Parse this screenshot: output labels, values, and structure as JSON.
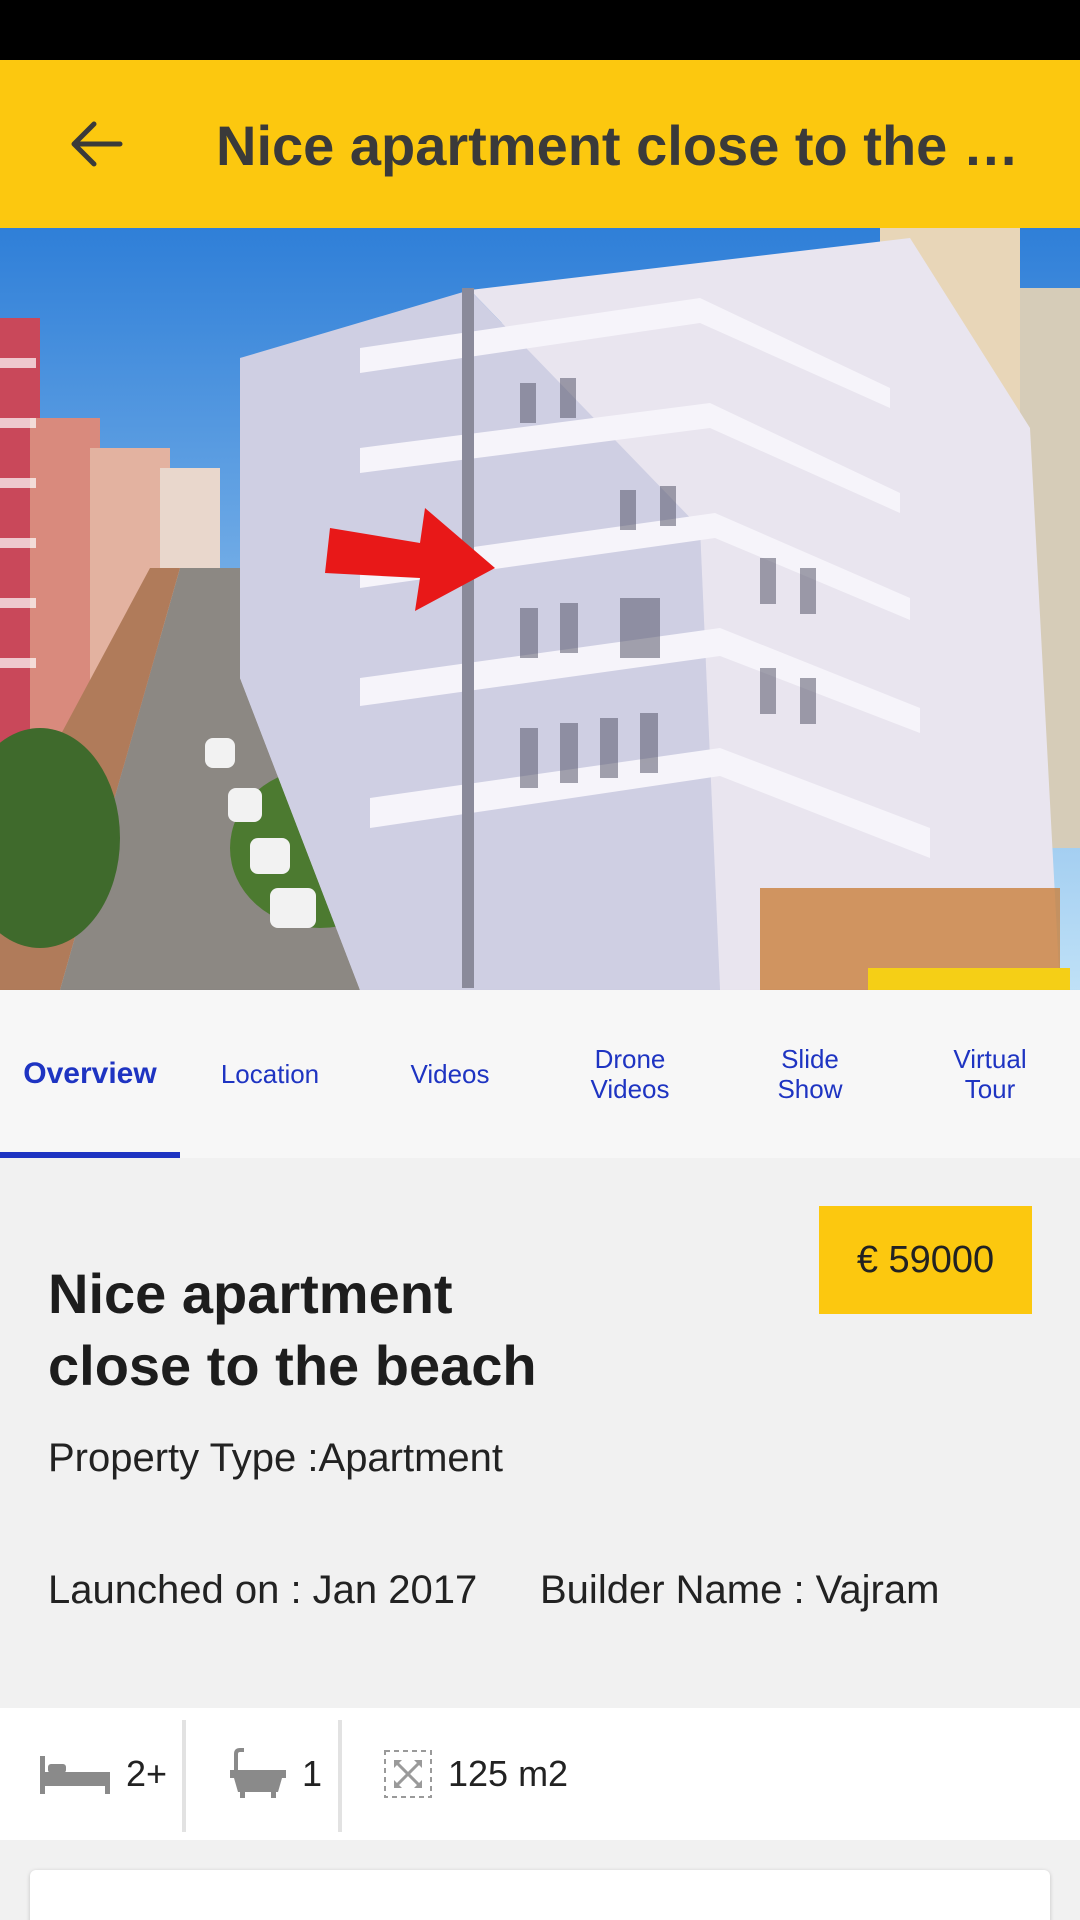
{
  "app_bar": {
    "title": "Nice apartment close to the beach",
    "back_icon": "arrow-left-icon",
    "background_color": "#fcc80f"
  },
  "tabs": [
    {
      "label": "Overview",
      "active": true
    },
    {
      "label": "Location",
      "active": false
    },
    {
      "label": "Videos",
      "active": false
    },
    {
      "label": "Drone\nVideos",
      "active": false
    },
    {
      "label": "Slide\nShow",
      "active": false
    },
    {
      "label": "Virtual\nTour",
      "active": false
    }
  ],
  "property": {
    "price": "€ 59000",
    "title": "Nice apartment close to the beach",
    "type": "Property Type :Apartment",
    "launched": "Launched on : Jan 2017",
    "builder": "Builder Name : Vajram"
  },
  "features": {
    "bedrooms": {
      "icon": "bed-icon",
      "value": "2+"
    },
    "bathrooms": {
      "icon": "bathtub-icon",
      "value": "1"
    },
    "area": {
      "icon": "area-icon",
      "value": "125 m2"
    }
  },
  "colors": {
    "accent": "#fcc80f",
    "tab_text": "#1e34c2"
  }
}
